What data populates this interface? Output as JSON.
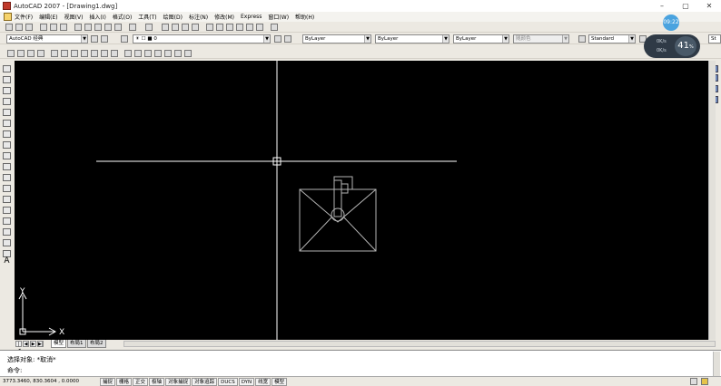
{
  "window": {
    "title": "AutoCAD 2007 - [Drawing1.dwg]",
    "minimize": "–",
    "maximize": "▢",
    "close": "✕"
  },
  "menu": [
    "文件(F)",
    "编辑(E)",
    "视图(V)",
    "插入(I)",
    "格式(O)",
    "工具(T)",
    "绘图(D)",
    "标注(N)",
    "修改(M)",
    "Express",
    "窗口(W)",
    "帮助(H)"
  ],
  "toolbar": {
    "workspace": "AutoCAD 经典",
    "layer": "0",
    "color": "ByLayer",
    "linetype": "ByLayer",
    "lineweight": "ByLayer",
    "plotstyle": "随颜色",
    "textstyle": "Standard",
    "dimstyle": "St"
  },
  "overlay": {
    "timer": "09:22",
    "up_rate": "0K/s",
    "down_rate": "0K/s",
    "percent": "41",
    "percent_unit": "%"
  },
  "axes": {
    "y_label": "Y",
    "x_label": "X"
  },
  "tabs": {
    "nav": [
      "|◀",
      "◀",
      "▶",
      "▶|"
    ],
    "items": [
      "模型",
      "布局1",
      "布局2"
    ]
  },
  "command": {
    "history": "选择对象: *取消*",
    "prompt": "命令:"
  },
  "status": {
    "coords": "3773.3460, 830.3604 , 0.0000",
    "buttons": [
      "捕捉",
      "栅格",
      "正交",
      "极轴",
      "对象捕捉",
      "对象追踪",
      "DUCS",
      "DYN",
      "线宽",
      "模型"
    ]
  },
  "colors": {
    "canvas": "#000000",
    "crosshair": "#ffffff",
    "geometry": "#b4b4b4"
  }
}
